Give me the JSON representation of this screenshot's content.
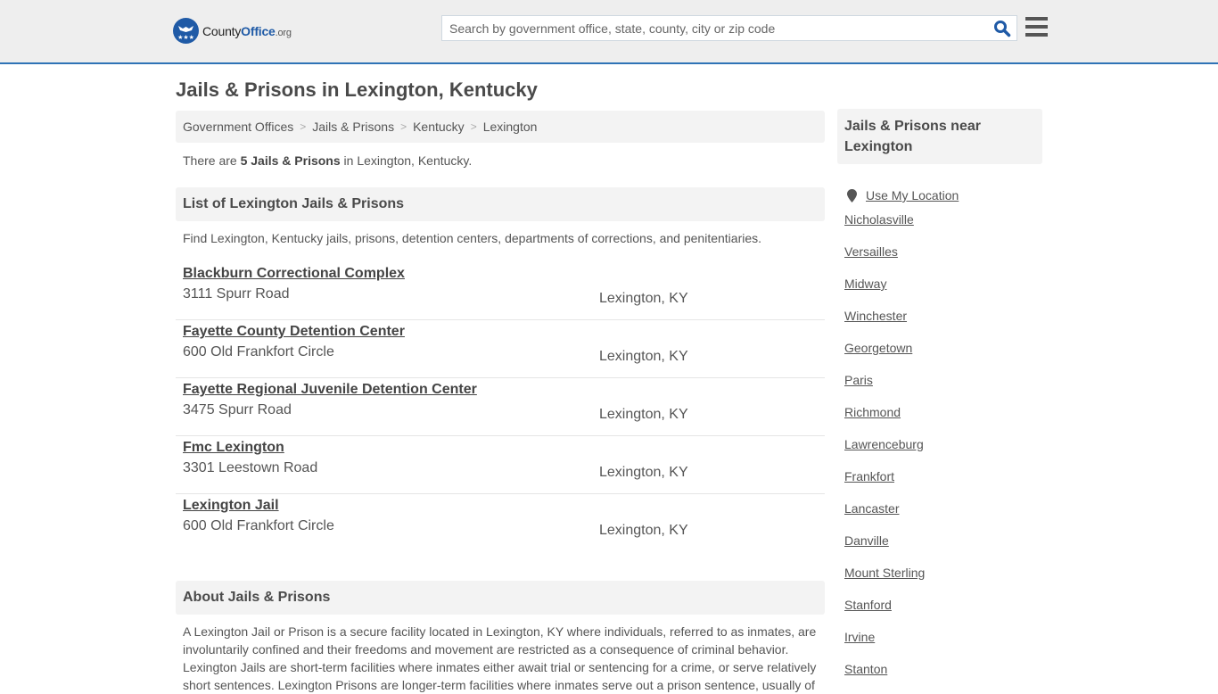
{
  "header": {
    "logo": {
      "name_part1": "County",
      "name_part2": "Office",
      "name_part3": ".org"
    },
    "search_placeholder": "Search by government office, state, county, city or zip code",
    "search_value": "",
    "colors": {
      "brand": "#1f5aa6",
      "border_accent": "#2f73b6"
    }
  },
  "page": {
    "title": "Jails & Prisons in Lexington, Kentucky"
  },
  "breadcrumb": [
    "Government Offices",
    "Jails & Prisons",
    "Kentucky",
    "Lexington"
  ],
  "summary": {
    "prefix": "There are ",
    "count_label": "5 Jails & Prisons",
    "suffix": " in Lexington, Kentucky."
  },
  "list_section": {
    "heading": "List of Lexington Jails & Prisons",
    "description": "Find Lexington, Kentucky jails, prisons, detention centers, departments of corrections, and penitentiaries.",
    "items": [
      {
        "name": "Blackburn Correctional Complex",
        "address": "3111 Spurr Road",
        "city": "Lexington, KY"
      },
      {
        "name": "Fayette County Detention Center",
        "address": "600 Old Frankfort Circle",
        "city": "Lexington, KY"
      },
      {
        "name": "Fayette Regional Juvenile Detention Center",
        "address": "3475 Spurr Road",
        "city": "Lexington, KY"
      },
      {
        "name": "Fmc Lexington",
        "address": "3301 Leestown Road",
        "city": "Lexington, KY"
      },
      {
        "name": "Lexington Jail",
        "address": "600 Old Frankfort Circle",
        "city": "Lexington, KY"
      }
    ]
  },
  "about_section": {
    "heading": "About Jails & Prisons",
    "text": "A Lexington Jail or Prison is a secure facility located in Lexington, KY where individuals, referred to as inmates, are involuntarily confined and their freedoms and movement are restricted as a consequence of criminal behavior. Lexington Jails are short-term facilities where inmates either await trial or sentencing for a crime, or serve relatively short sentences. Lexington Prisons are longer-term facilities where inmates serve out a prison sentence, usually of"
  },
  "sidebar": {
    "heading": "Jails & Prisons near Lexington",
    "use_location": "Use My Location",
    "nearby": [
      "Nicholasville",
      "Versailles",
      "Midway",
      "Winchester",
      "Georgetown",
      "Paris",
      "Richmond",
      "Lawrenceburg",
      "Frankfort",
      "Lancaster",
      "Danville",
      "Mount Sterling",
      "Stanford",
      "Irvine",
      "Stanton"
    ]
  },
  "icons": {
    "search": "search-icon",
    "menu": "hamburger-menu-icon",
    "location": "map-pin-icon",
    "logo": "eagle-stars-logo-icon"
  }
}
